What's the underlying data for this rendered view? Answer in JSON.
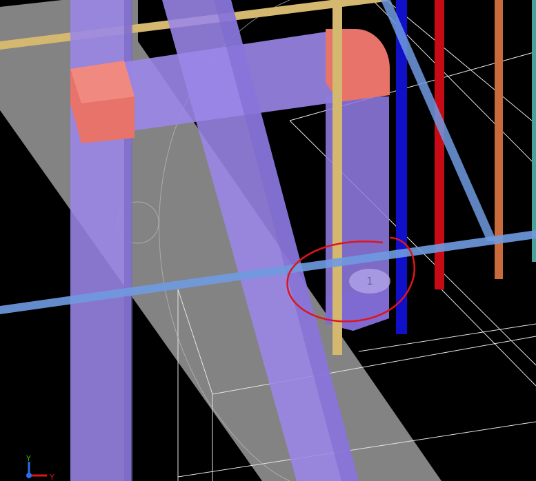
{
  "viewport": {
    "background": "#000000",
    "marker": {
      "label": "1",
      "annotation_color": "#e0141c"
    },
    "axis_triad": {
      "vertical_label": "Y",
      "horizontal_label": "Y"
    }
  },
  "colors": {
    "duct": "#9b86e8",
    "duct_fitting": "#e8736a",
    "floor_slab": "#8a8a8a",
    "pipe_blue": "#1010c8",
    "pipe_red": "#c80a14",
    "pipe_orange": "#c86a3c",
    "pipe_light_blue": "#6f9ae0",
    "pipe_yellow": "#d4b870",
    "grid_lines": "#ffffff",
    "annotation": "#e0141c"
  }
}
